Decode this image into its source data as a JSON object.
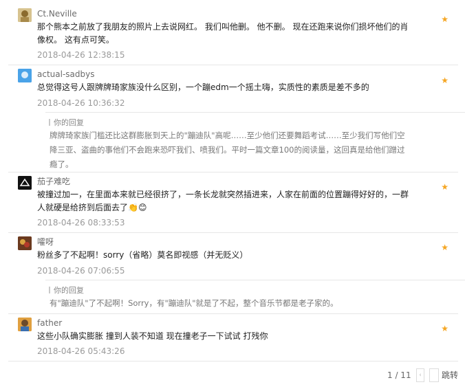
{
  "comments": [
    {
      "user": "Ct.Neville",
      "text": "那个熊本之前放了我朋友的照片上去说网红。 我们叫他删。 他不删。 现在还跑来说你们损坏他们的肖像权。 这有点可笑。",
      "time": "2018-04-26 12:38:15",
      "avatar_color": "#c9b27a"
    },
    {
      "user": "actual-sadbys",
      "text": "总觉得这号人跟牌牌琦家族没什么区别，一个蹦edm一个摇土嗨，实质性的素质是差不多的",
      "time": "2018-04-26 10:36:32",
      "avatar_color": "#3a8fd6",
      "reply": {
        "label": "你的回复",
        "text": "牌牌琦家族门槛还比这群膨胀到天上的\"蹦迪队\"高呢……至少他们还要舞蹈考试……至少我们写他们空降三亚、盗曲的事他们不会跑来恐吓我们、喷我们。平时一篇文章100的阅读量，这回真是给他们蹭过瘾了。"
      }
    },
    {
      "user": "茄子难吃",
      "text": "被撞过加一，在里面本来就已经很挤了，一条长龙就突然插进来，人家在前面的位置蹦得好好的，一群人就硬是给挤到后面去了👏😊",
      "time": "2018-04-26 08:33:53",
      "avatar_color": "#1a1a1a"
    },
    {
      "user": "嚯呀",
      "text": "粉丝多了不起啊！sorry（省略）莫名即视感（并无贬义）",
      "time": "2018-04-26 07:06:55",
      "avatar_color": "#8a4a2a",
      "reply": {
        "label": "你的回复",
        "text": "有\"蹦迪队\"了不起啊！Sorry，有\"蹦迪队\"就是了不起，整个音乐节都是老子家的。"
      }
    },
    {
      "user": "father",
      "text": "这些小队确实膨胀 撞到人装不知道 现在撞老子一下试试 打残你",
      "time": "2018-04-26 05:43:26",
      "avatar_color": "#d98a2b"
    }
  ],
  "icons": {
    "star": "star-icon"
  },
  "pagination": {
    "status": "1 / 11",
    "prev": "‹",
    "jump_label": "跳转",
    "jump_value": ""
  }
}
